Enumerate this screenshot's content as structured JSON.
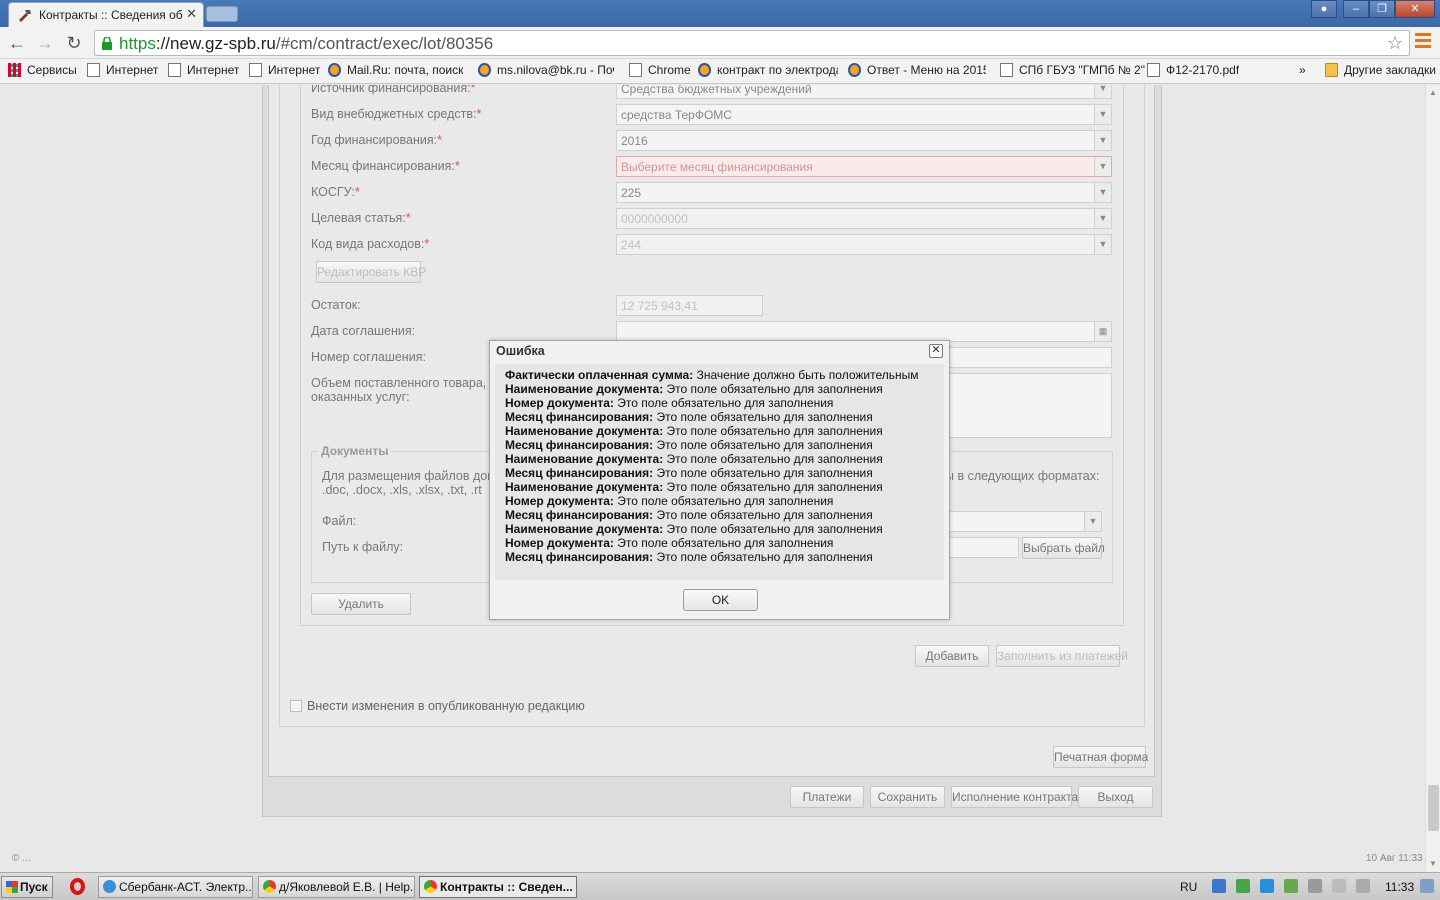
{
  "browser": {
    "tab_title": "Контракты :: Сведения об",
    "url_scheme": "https",
    "url_host": "://new.gz-spb.ru",
    "url_path": "/#cm/contract/exec/lot/80356",
    "bookmarks": [
      {
        "label": "Сервисы",
        "icon": "apps-icon"
      },
      {
        "label": "Интернет",
        "icon": "page-icon"
      },
      {
        "label": "Интернет",
        "icon": "page-icon"
      },
      {
        "label": "Интернет",
        "icon": "page-icon"
      },
      {
        "label": "Mail.Ru: почта, поиск в",
        "icon": "mail-icon"
      },
      {
        "label": "ms.nilova@bk.ru - Поч",
        "icon": "mail-icon"
      },
      {
        "label": "Chrome",
        "icon": "page-icon"
      },
      {
        "label": "контракт по электрода",
        "icon": "mail-icon"
      },
      {
        "label": "Ответ - Меню на 2015",
        "icon": "mail-icon"
      },
      {
        "label": "СПб ГБУЗ \"ГМПб № 2\"",
        "icon": "page-icon"
      },
      {
        "label": "Ф12-2170.pdf",
        "icon": "page-icon"
      }
    ],
    "bookmarks_overflow": "»",
    "other_bookmarks": "Другие закладки"
  },
  "form": {
    "source_label": "Источник финансирования:",
    "source_value": "Средства бюджетных учреждений",
    "offbudget_label": "Вид внебюджетных средств:",
    "offbudget_value": "средства ТерФОМС",
    "year_label": "Год финансирования:",
    "year_value": "2016",
    "month_label": "Месяц финансирования:",
    "month_placeholder": "Выберите месяц финансирования",
    "kosgu_label": "КОСГУ:",
    "kosgu_value": "225",
    "target_label": "Целевая статья:",
    "target_value": "0000000000",
    "kvr_label": "Код вида расходов:",
    "kvr_value": "244",
    "edit_kvr_button": "Редактировать КВР",
    "balance_label": "Остаток:",
    "balance_value": "12 725 943,41",
    "agreement_date_label": "Дата соглашения:",
    "agreement_number_label": "Номер соглашения:",
    "volume_label_1": "Объем поставленного товара, в",
    "volume_label_2": "оказанных услуг:",
    "required_mark": "*",
    "docs_legend": "Документы",
    "docs_text_1": "Для размещения файлов доку",
    "docs_text_1b": "ы в следующих форматах:",
    "docs_text_2": ".doc, .docx, .xls, .xlsx, .txt, .rt",
    "file_label": "Файл:",
    "file_path_label": "Путь к файлу:",
    "choose_file_button": "Выбрать файл",
    "delete_button": "Удалить",
    "add_button": "Добавить",
    "fill_from_payments_button": "Заполнить из платежей",
    "publish_changes_label": "Внести изменения в опубликованную редакцию",
    "print_form_button": "Печатная форма",
    "payments_button": "Платежи",
    "save_button": "Сохранить",
    "contract_execution_button": "Исполнение контракта",
    "exit_button": "Выход"
  },
  "footer": {
    "copyright": "© ...",
    "date": "10 Авг 11:33"
  },
  "dialog": {
    "title": "Ошибка",
    "errors": [
      {
        "field": "Фактически оплаченная сумма:",
        "message": "Значение должно быть положительным"
      },
      {
        "field": "Наименование документа:",
        "message": "Это поле обязательно для заполнения"
      },
      {
        "field": "Номер документа:",
        "message": "Это поле обязательно для заполнения"
      },
      {
        "field": "Месяц финансирования:",
        "message": "Это поле обязательно для заполнения"
      },
      {
        "field": "Наименование документа:",
        "message": "Это поле обязательно для заполнения"
      },
      {
        "field": "Месяц финансирования:",
        "message": "Это поле обязательно для заполнения"
      },
      {
        "field": "Наименование документа:",
        "message": "Это поле обязательно для заполнения"
      },
      {
        "field": "Месяц финансирования:",
        "message": "Это поле обязательно для заполнения"
      },
      {
        "field": "Наименование документа:",
        "message": "Это поле обязательно для заполнения"
      },
      {
        "field": "Номер документа:",
        "message": "Это поле обязательно для заполнения"
      },
      {
        "field": "Месяц финансирования:",
        "message": "Это поле обязательно для заполнения"
      },
      {
        "field": "Наименование документа:",
        "message": "Это поле обязательно для заполнения"
      },
      {
        "field": "Номер документа:",
        "message": "Это поле обязательно для заполнения"
      },
      {
        "field": "Месяц финансирования:",
        "message": "Это поле обязательно для заполнения"
      }
    ],
    "ok_button": "OK"
  },
  "taskbar": {
    "start": "Пуск",
    "items": [
      {
        "label": "Сбербанк-АСТ. Электр..."
      },
      {
        "label": "д/Яковлевой Е.В. | Help..."
      },
      {
        "label": "Контракты :: Сведен..."
      }
    ],
    "lang": "RU",
    "clock": "11:33"
  },
  "colors": {
    "titlebar": "#3b68a6",
    "error_field": "#fbeaea",
    "required": "#d9534f"
  }
}
